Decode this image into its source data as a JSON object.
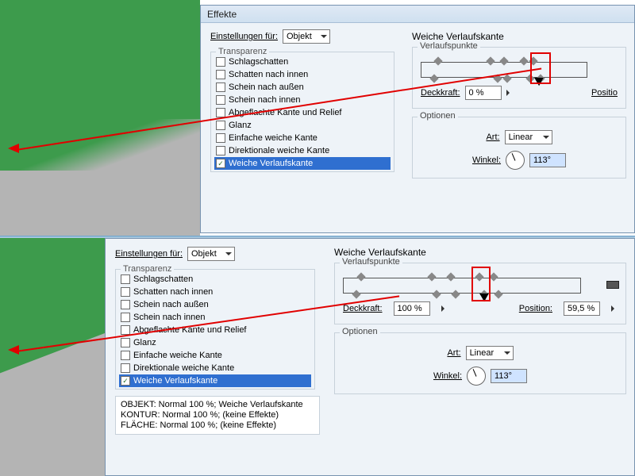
{
  "dialog": {
    "title": "Effekte"
  },
  "settings_for_label": "Einstellungen für:",
  "settings_for_value": "Objekt",
  "fx_legend": "Transparenz",
  "fx_items": [
    {
      "label": "Schlagschatten",
      "checked": false
    },
    {
      "label": "Schatten nach innen",
      "checked": false
    },
    {
      "label": "Schein nach außen",
      "checked": false
    },
    {
      "label": "Schein nach innen",
      "checked": false
    },
    {
      "label": "Abgeflachte Kante und Relief",
      "checked": false
    },
    {
      "label": "Glanz",
      "checked": false
    },
    {
      "label": "Einfache weiche Kante",
      "checked": false
    },
    {
      "label": "Direktionale weiche Kante",
      "checked": false
    },
    {
      "label": "Weiche Verlaufskante",
      "checked": true,
      "selected": true
    }
  ],
  "section_title": "Weiche Verlaufskante",
  "grad_group_legend": "Verlaufspunkte",
  "opacity_label": "Deckkraft:",
  "position_label": "Position:",
  "options_legend": "Optionen",
  "type_label": "Art:",
  "type_value": "Linear",
  "angle_label": "Winkel:",
  "angle_value": "113°",
  "top_state": {
    "opacity": "0 %",
    "position_label_only": "Positio"
  },
  "bot_state": {
    "opacity": "100 %",
    "position": "59,5 %"
  },
  "summary_lines": {
    "l1": "OBJEKT: Normal 100 %; Weiche Verlaufskante",
    "l2": "KONTUR: Normal 100 %; (keine Effekte)",
    "l3": "FLÄCHE: Normal 100 %; (keine Effekte)"
  }
}
